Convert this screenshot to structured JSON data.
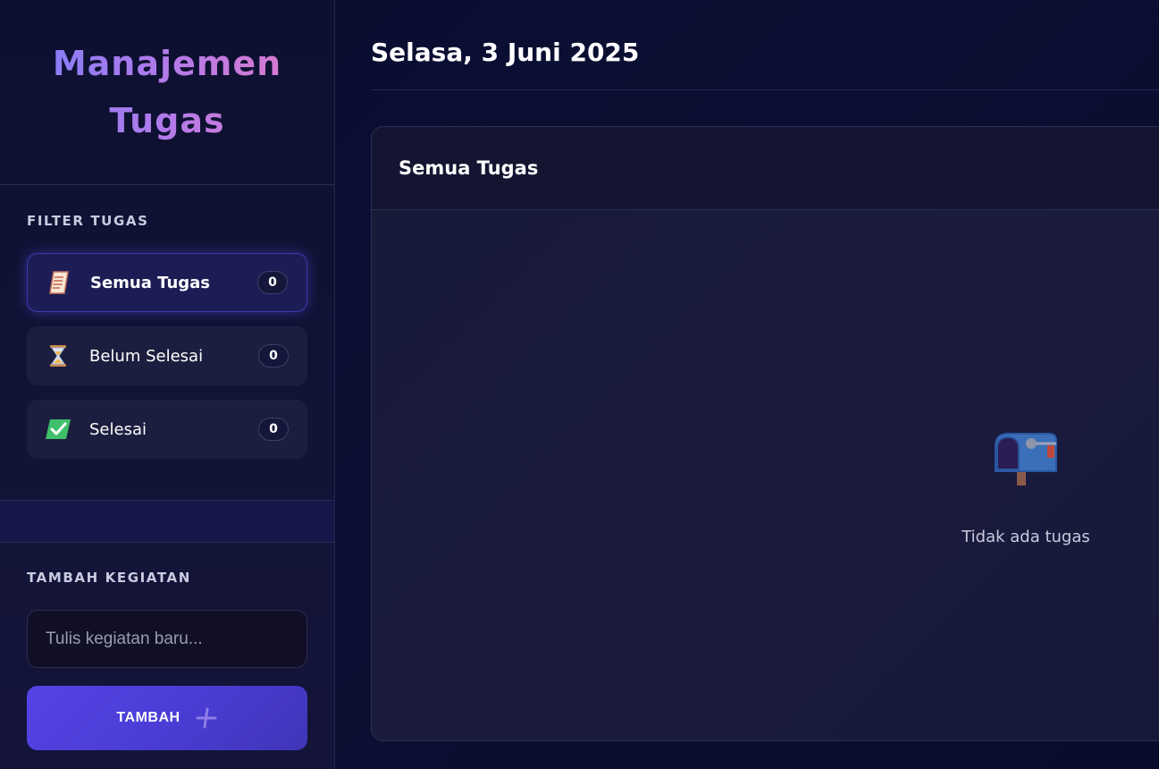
{
  "sidebar": {
    "brand_title": "Manajemen Tugas",
    "filter_heading": "FILTER TUGAS",
    "filters": [
      {
        "label": "Semua Tugas",
        "count": "0",
        "icon": "memo-icon",
        "active": true
      },
      {
        "label": "Belum Selesai",
        "count": "0",
        "icon": "hourglass-icon",
        "active": false
      },
      {
        "label": "Selesai",
        "count": "0",
        "icon": "check-mark-icon",
        "active": false
      }
    ],
    "add_heading": "TAMBAH KEGIATAN",
    "input": {
      "value": "",
      "placeholder": "Tulis kegiatan baru..."
    },
    "add_button_label": "TAMBAH"
  },
  "main": {
    "date": "Selasa, 3 Juni 2025",
    "panel_title": "Semua Tugas",
    "empty_text": "Tidak ada tugas",
    "empty_icon": "mailbox-icon"
  },
  "colors": {
    "accent": "#5544e4",
    "brand_gradient_start": "#8b7cf6",
    "brand_gradient_end": "#d77ad0",
    "background": "#0a0e30"
  }
}
